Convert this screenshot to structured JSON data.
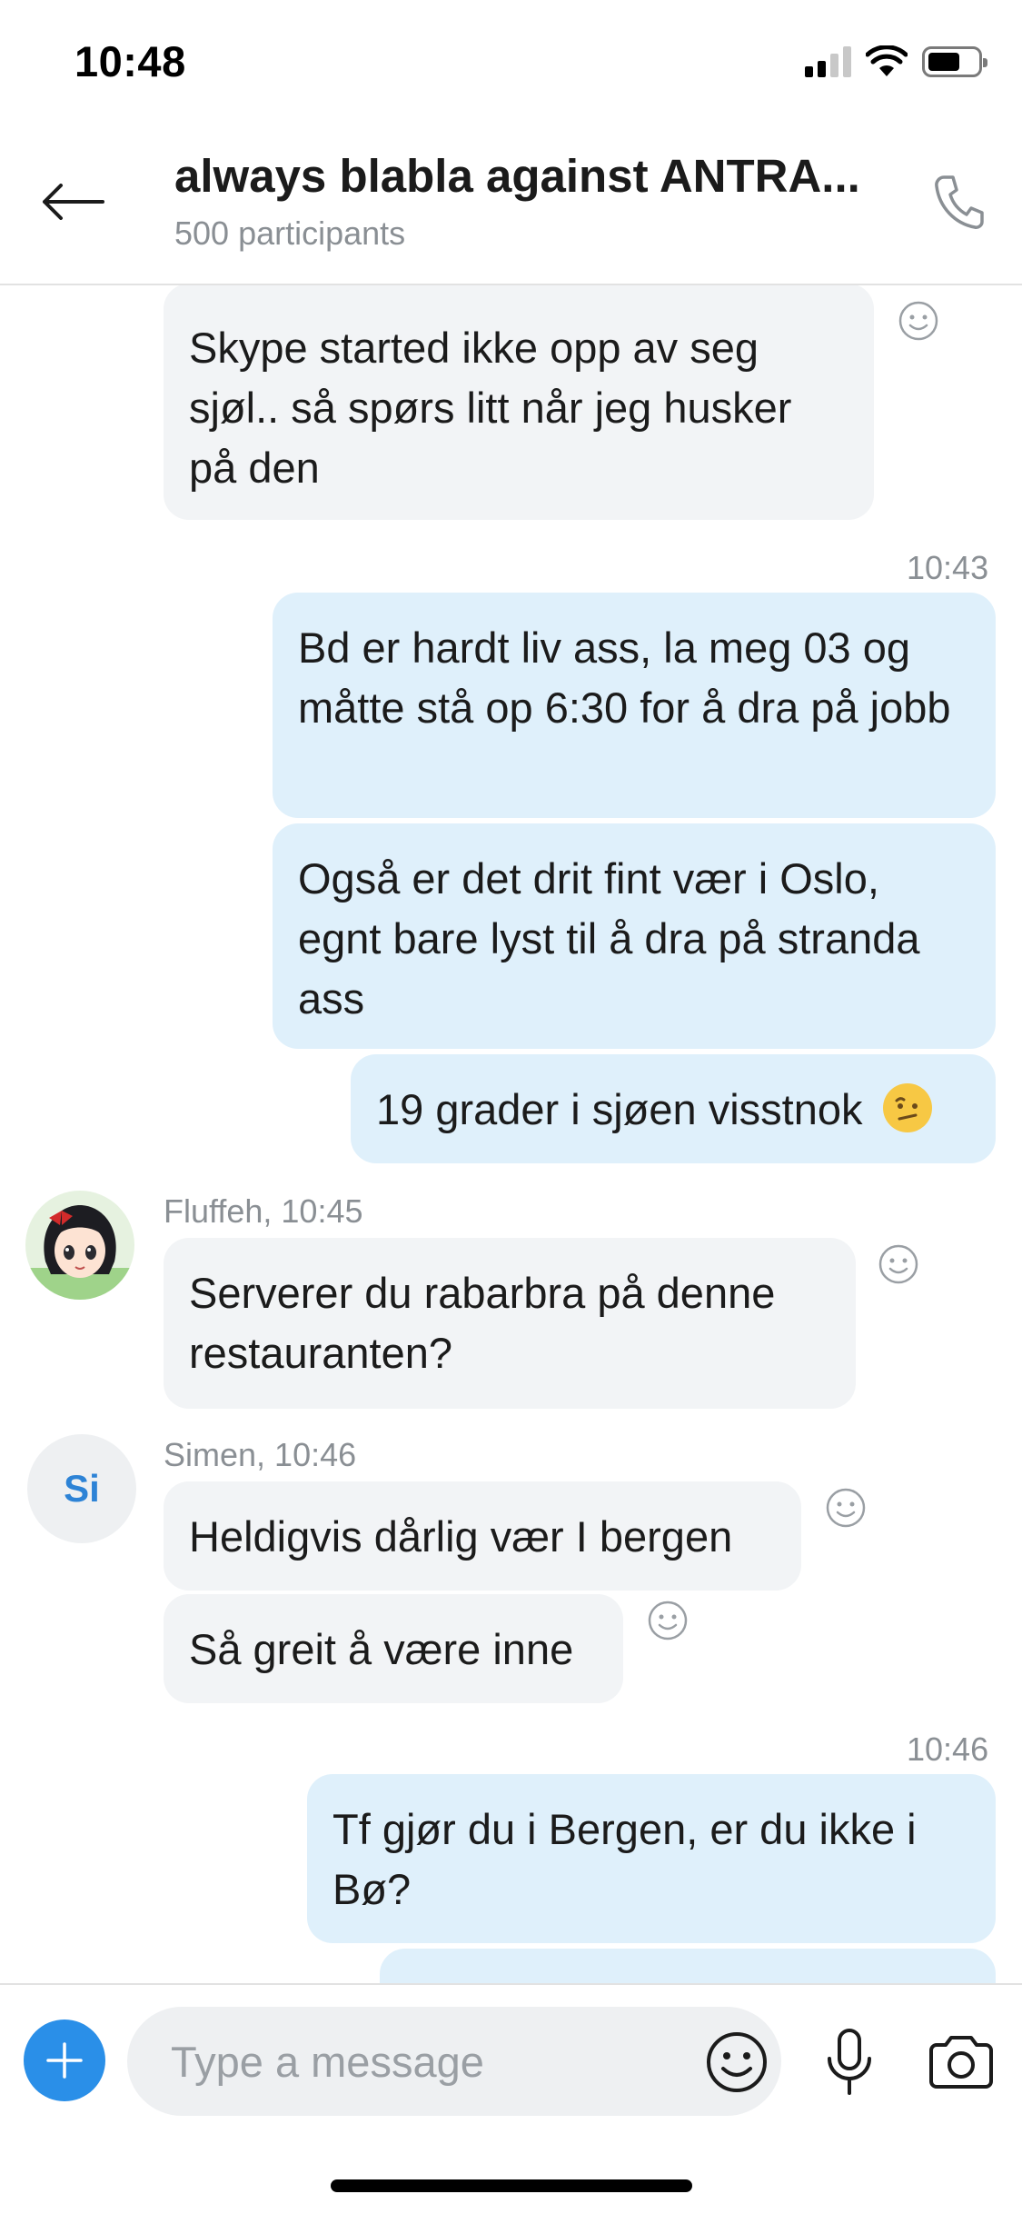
{
  "status_bar": {
    "time": "10:48"
  },
  "header": {
    "title": "always blabla against ANTRA...",
    "subtitle": "500 participants"
  },
  "messages": [
    {
      "text": "Skype started ikke opp av seg sjøl.. så spørs litt når jeg husker på den"
    },
    {
      "timestamp": "10:43"
    },
    {
      "text": "Bd er hardt liv ass, la meg 03 og måtte stå op 6:30 for å dra på jobb"
    },
    {
      "text": "Også er det drit fint vær i Oslo, egnt bare lyst til å dra på stranda ass"
    },
    {
      "text": "19 grader i sjøen visstnok"
    },
    {
      "sender": "Fluffeh, 10:45",
      "text": "Serverer du rabarbra på denne restauranten?"
    },
    {
      "sender": "Simen, 10:46",
      "avatar_initials": "Si",
      "text": "Heldigvis dårlig vær I bergen"
    },
    {
      "text": "Så greit å være inne"
    },
    {
      "timestamp": "10:46"
    },
    {
      "text": "Tf gjør du i Bergen, er du ikke i Bø?"
    },
    {
      "text": "..."
    }
  ],
  "composer": {
    "placeholder": "Type a message"
  },
  "icons": {
    "back": "arrow-left-icon",
    "call": "phone-icon",
    "plus": "plus-icon",
    "emoji": "smiley-icon",
    "mic": "microphone-icon",
    "camera": "camera-icon",
    "reaction": "smiley-reaction-icon"
  },
  "colors": {
    "incoming_bubble": "#f2f4f6",
    "outgoing_bubble": "#dff0fb",
    "accent": "#2a8fe8",
    "muted_text": "#8a8f94"
  }
}
